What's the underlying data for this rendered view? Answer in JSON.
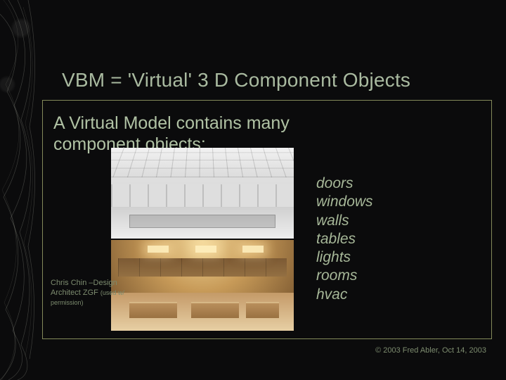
{
  "title": "VBM = 'Virtual' 3 D Component Objects",
  "subtitle": "A Virtual Model contains many component objects:",
  "objects": {
    "i0": "doors",
    "i1": "windows",
    "i2": "walls",
    "i3": "tables",
    "i4": "lights",
    "i5": "rooms",
    "i6": "hvac"
  },
  "credit": {
    "line1": "Chris Chin –Design",
    "line2": "Architect  ZGF",
    "perm": "(used w/ permission)"
  },
  "copyright": "© 2003  Fred Abler, Oct 14, 2003"
}
